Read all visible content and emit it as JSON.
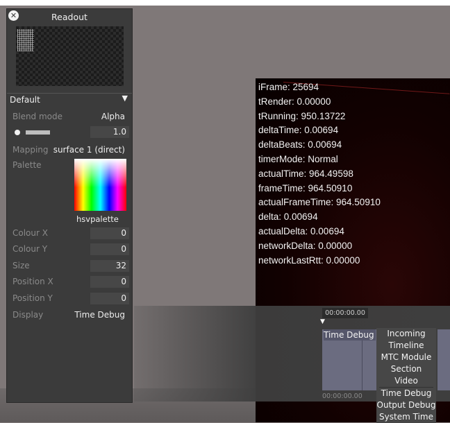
{
  "panel": {
    "title": "Readout",
    "section": "Default",
    "rows": {
      "blend_mode": {
        "label": "Blend mode",
        "value": "Alpha"
      },
      "opacity": {
        "value": "1.0"
      },
      "mapping": {
        "label": "Mapping",
        "value": "surface 1 (direct)"
      },
      "palette": {
        "label": "Palette",
        "name": "hsvpalette"
      },
      "colour_x": {
        "label": "Colour X",
        "value": "0"
      },
      "colour_y": {
        "label": "Colour Y",
        "value": "0"
      },
      "size": {
        "label": "Size",
        "value": "32"
      },
      "position_x": {
        "label": "Position X",
        "value": "0"
      },
      "position_y": {
        "label": "Position Y",
        "value": "0"
      },
      "display": {
        "label": "Display",
        "value": "Time Debug"
      }
    }
  },
  "readout_lines": [
    "iFrame: 25694",
    "tRender: 0.00000",
    "tRunning: 950.13722",
    "deltaTime: 0.00694",
    "deltaBeats: 0.00694",
    "timerMode: Normal",
    "actualTime: 964.49598",
    "frameTime: 964.50910",
    "actualFrameTime: 964.50910",
    "delta: 0.00694",
    "actualDelta: 0.00694",
    "networkDelta: 0.00000",
    "networkLastRtt: 0.00000"
  ],
  "timeline": {
    "time_start": "00:00:00.00",
    "time_end": "00:00:00.00",
    "track_label": "Time Debug"
  },
  "dropdown": {
    "items": [
      "Incoming",
      "Timeline",
      "MTC Module",
      "Section",
      "Video",
      "Time Debug",
      "Output Debug",
      "System Time"
    ]
  },
  "icons": {
    "close": "close-icon",
    "section_arrow": "chevron-down-icon",
    "playhead": "playhead-icon"
  }
}
